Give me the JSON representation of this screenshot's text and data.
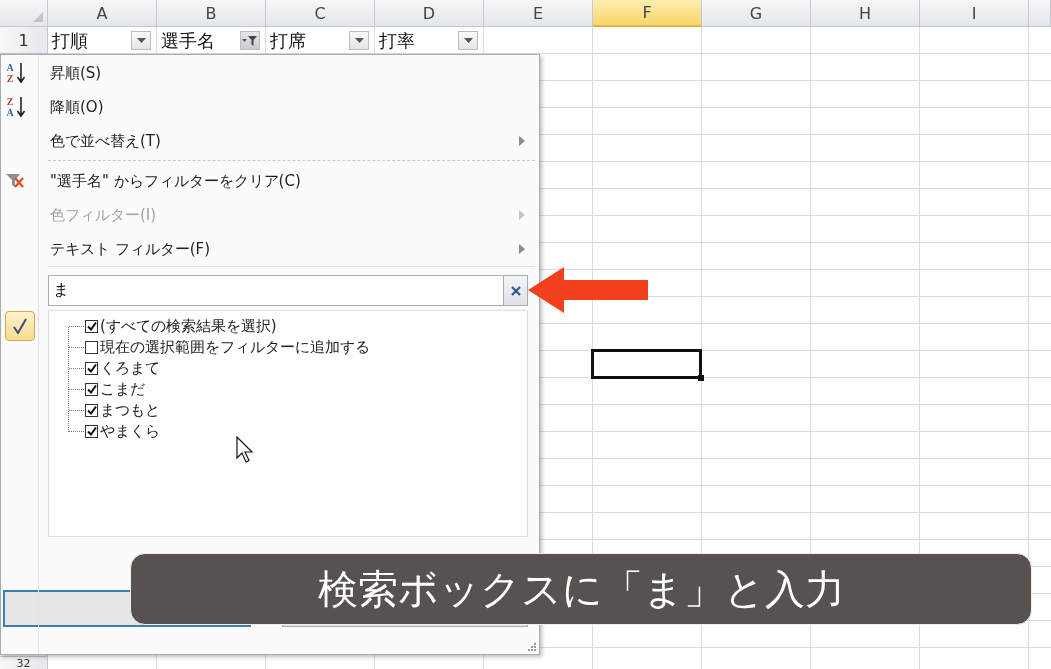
{
  "sheet": {
    "columns": [
      {
        "label": "A",
        "selected": false
      },
      {
        "label": "B",
        "selected": false
      },
      {
        "label": "C",
        "selected": false
      },
      {
        "label": "D",
        "selected": false
      },
      {
        "label": "E",
        "selected": false
      },
      {
        "label": "F",
        "selected": true
      },
      {
        "label": "G",
        "selected": false
      },
      {
        "label": "H",
        "selected": false
      },
      {
        "label": "I",
        "selected": false
      }
    ],
    "row_headers": [
      "1",
      "32"
    ],
    "header_cells": [
      {
        "text": "打順",
        "filtered": false
      },
      {
        "text": "選手名",
        "filtered": true
      },
      {
        "text": "打席",
        "filtered": false
      },
      {
        "text": "打率",
        "filtered": false
      }
    ]
  },
  "filter_menu": {
    "items": [
      {
        "kind": "sort_ascending",
        "icon_letters": [
          "A",
          "Z"
        ],
        "label": "昇順(S)",
        "disabled": false,
        "submenu": false
      },
      {
        "kind": "sort_descending",
        "icon_letters": [
          "Z",
          "A"
        ],
        "label": "降順(O)",
        "disabled": false,
        "submenu": false
      },
      {
        "kind": "plain",
        "label": "色で並べ替え(T)",
        "disabled": false,
        "submenu": true
      },
      {
        "kind": "separator"
      },
      {
        "kind": "clear_filter",
        "label": "\"選手名\" からフィルターをクリア(C)",
        "disabled": false,
        "submenu": false
      },
      {
        "kind": "plain",
        "label": "色フィルター(I)",
        "disabled": true,
        "submenu": true
      },
      {
        "kind": "plain",
        "label": "テキスト フィルター(F)",
        "disabled": false,
        "submenu": true
      }
    ],
    "search": {
      "value": "ま"
    },
    "results": [
      {
        "label": "(すべての検索結果を選択)",
        "checked": true
      },
      {
        "label": "現在の選択範囲をフィルターに追加する",
        "checked": false
      },
      {
        "label": "くろまて",
        "checked": true
      },
      {
        "label": "こまだ",
        "checked": true
      },
      {
        "label": "まつもと",
        "checked": true
      },
      {
        "label": "やまくら",
        "checked": true
      }
    ],
    "buttons": [
      {
        "focused": true
      },
      {
        "focused": false
      }
    ]
  },
  "caption": "検索ボックスに「ま」と入力"
}
